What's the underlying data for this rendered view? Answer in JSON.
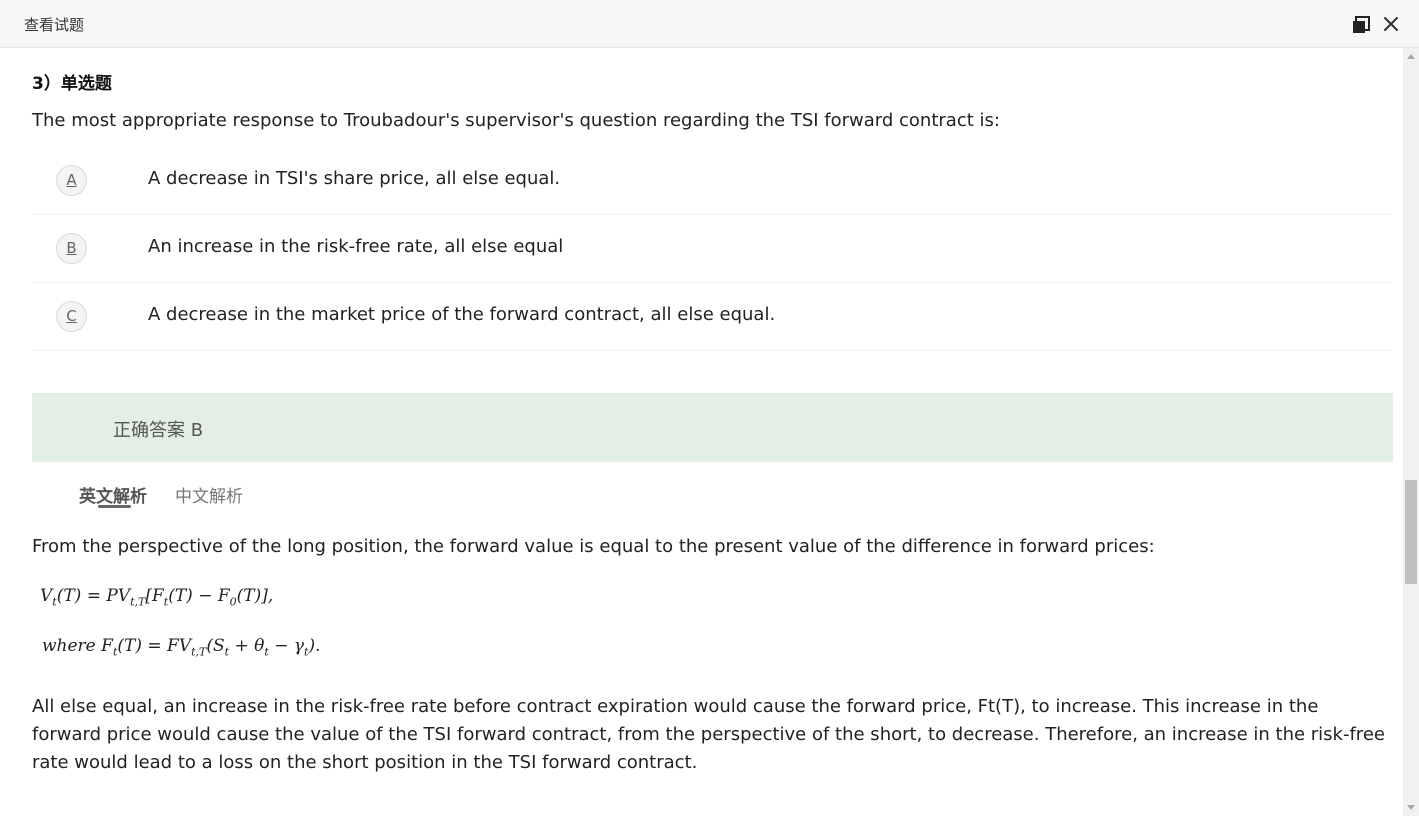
{
  "window": {
    "title": "查看试题",
    "restore_icon": "restore-window-icon",
    "close_icon": "close-icon"
  },
  "question": {
    "header": "3）单选题",
    "text": "The most appropriate response to Troubadour's supervisor's question regarding the TSI forward contract is:",
    "options": [
      {
        "letter": "A",
        "text": "A decrease in TSI's share price, all else equal."
      },
      {
        "letter": "B",
        "text": "An increase in the risk-free rate, all else equal"
      },
      {
        "letter": "C",
        "text": "A decrease in the market price of the forward contract, all else equal."
      }
    ]
  },
  "answer": {
    "text": "正确答案 B"
  },
  "tabs": {
    "english": "英文解析",
    "chinese": "中文解析",
    "selected": "英文解析"
  },
  "explanation": {
    "intro": "From the perspective of the long position, the forward value is equal to the present value of the difference in forward prices:",
    "conclusion": "All else equal, an increase in the risk-free rate before contract expiration would cause the forward price, Ft(T), to increase. This increase in the forward price would cause the value of the TSI forward contract, from the perspective of the short, to decrease. Therefore, an increase in the risk-free rate would lead to a loss on the short position in the TSI forward contract."
  },
  "colors": {
    "answer_bg": "#e3efe6",
    "titlebar_bg": "#f7f7f7"
  }
}
